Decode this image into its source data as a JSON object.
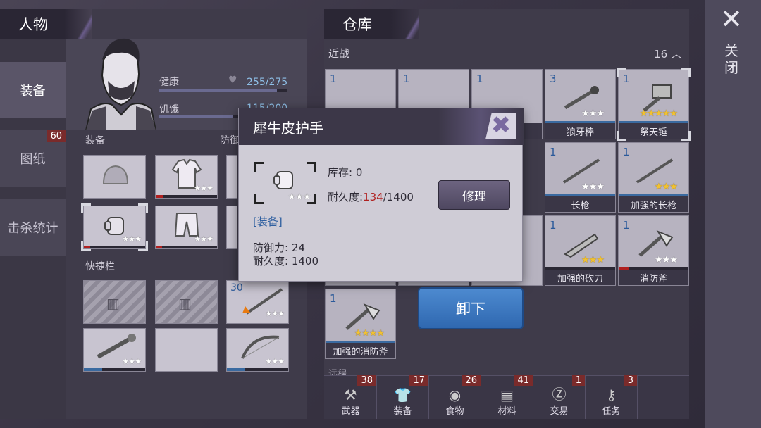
{
  "character": {
    "title": "人物",
    "health_label": "健康",
    "health_value": "255/275",
    "hunger_label": "饥饿",
    "hunger_value": "115/200",
    "equipment_label": "装备",
    "defense_label": "防御",
    "quickbar_label": "快捷栏",
    "quickbar_count": "30"
  },
  "nav": {
    "items": [
      {
        "label": "装备"
      },
      {
        "label": "图纸",
        "badge": "60"
      },
      {
        "label": "击杀统计"
      }
    ]
  },
  "warehouse": {
    "title": "仓库",
    "category": "近战",
    "category_count": "16",
    "items": [
      {
        "count": "1",
        "name": "",
        "stars": "★★★"
      },
      {
        "count": "1",
        "name": "",
        "stars": "★★★"
      },
      {
        "count": "1",
        "name": "棍",
        "stars": "★★★"
      },
      {
        "count": "3",
        "name": "狼牙棒",
        "stars": "★★★"
      },
      {
        "count": "1",
        "name": "祭天锤",
        "stars": "★★★★★"
      },
      {
        "count": "1",
        "name": "长枪",
        "stars": "★★★"
      },
      {
        "count": "1",
        "name": "加强的长枪",
        "stars": "★★★"
      },
      {
        "count": "1",
        "name": "加强的砍刀",
        "stars": "★★★"
      },
      {
        "count": "1",
        "name": "消防斧",
        "stars": "★★★"
      },
      {
        "count": "1",
        "name": "加强的消防斧",
        "stars": "★★★★"
      }
    ],
    "next_category": "远程"
  },
  "bottom_tabs": [
    {
      "label": "武器",
      "badge": "38"
    },
    {
      "label": "装备",
      "badge": "17"
    },
    {
      "label": "食物",
      "badge": "26"
    },
    {
      "label": "材料",
      "badge": "41"
    },
    {
      "label": "交易",
      "badge": "1"
    },
    {
      "label": "任务",
      "badge": "3"
    }
  ],
  "close_label": "关闭",
  "modal": {
    "title": "犀牛皮护手",
    "stock_label": "库存: 0",
    "durability_label": "耐久度:",
    "durability_current": "134",
    "durability_max": "/1400",
    "repair_label": "修理",
    "tag": "[装备]",
    "defense": "防御力: 24",
    "durability_full": "耐久度: 1400",
    "item_stars": "★★★"
  },
  "unequip_label": "卸下",
  "colors": {
    "accent_blue": "#2f68b0",
    "durability_red": "#b02020",
    "star_gold": "#f2c230"
  }
}
